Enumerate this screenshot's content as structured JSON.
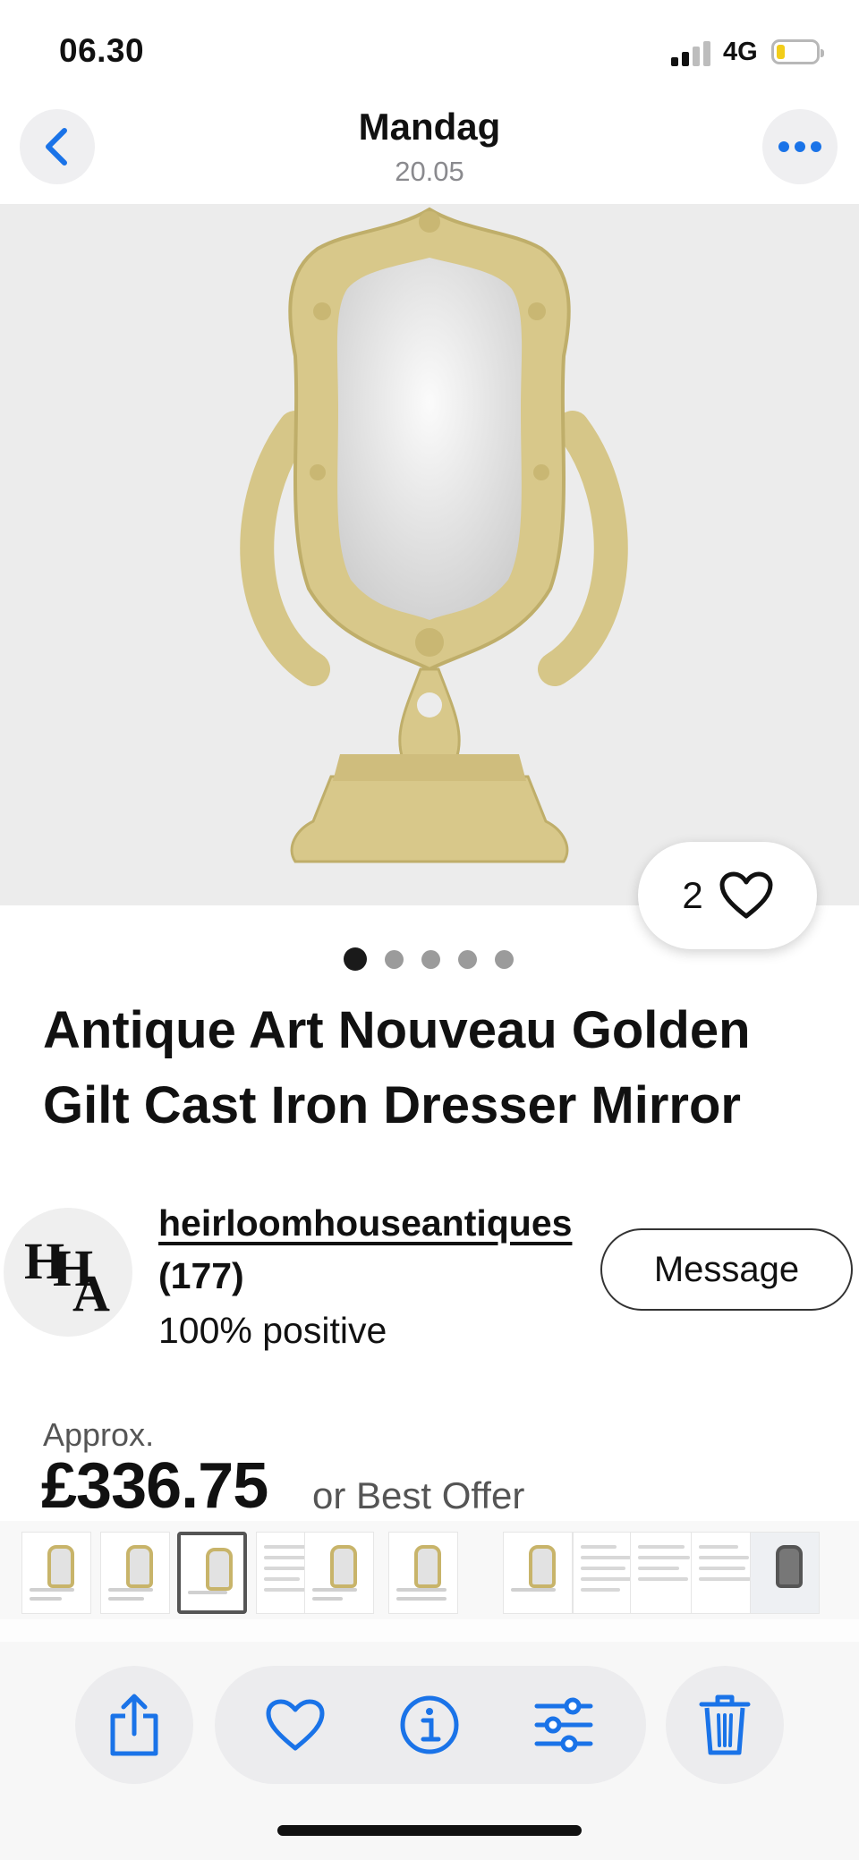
{
  "status_bar": {
    "time": "06.30",
    "network": "4G"
  },
  "nav": {
    "title": "Mandag",
    "subtitle": "20.05"
  },
  "colors": {
    "accent": "#1a73e8",
    "photo_bg": "#ececec",
    "gold": "#d8c88a"
  },
  "listing": {
    "watch_count": "2",
    "photo_count": 5,
    "active_photo": 1,
    "title": "Antique Art Nouveau Golden Gilt Cast Iron Dresser Mirror"
  },
  "seller": {
    "username": "heirloomhouseantiques",
    "feedback_count": "(177)",
    "positive": "100% positive",
    "avatar_initials": "HHA",
    "message_label": "Message"
  },
  "price": {
    "approx_label": "Approx.",
    "amount": "£336.75",
    "offer_label": "or Best Offer"
  },
  "toolbar": {
    "icons": [
      "share-icon",
      "heart-icon",
      "info-icon",
      "adjust-icon",
      "trash-icon"
    ]
  }
}
